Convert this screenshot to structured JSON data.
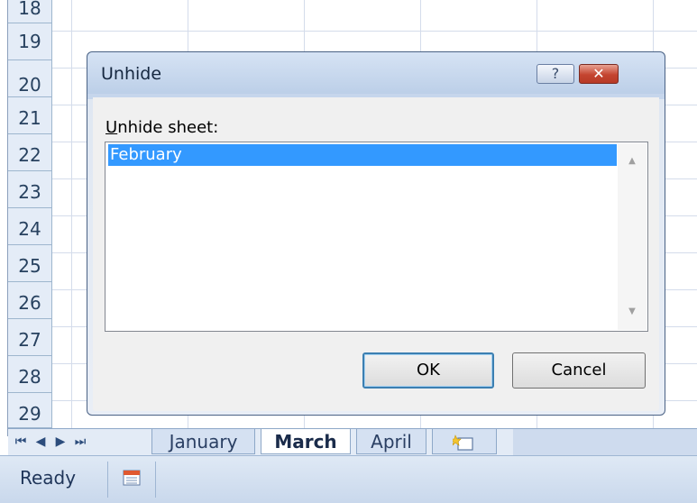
{
  "spreadsheet": {
    "row_numbers": [
      "18",
      "19",
      "20",
      "21",
      "22",
      "23",
      "24",
      "25",
      "26",
      "27",
      "28",
      "29"
    ]
  },
  "sheet_tabs": {
    "nav_icons": [
      "first-sheet-icon",
      "prev-sheet-icon",
      "next-sheet-icon",
      "last-sheet-icon"
    ],
    "tabs": [
      {
        "label": "January",
        "active": false
      },
      {
        "label": "March",
        "active": true
      },
      {
        "label": "April",
        "active": false
      }
    ],
    "insert_sheet_icon": "insert-sheet-icon"
  },
  "status_bar": {
    "status": "Ready",
    "icon": "macro-record-icon"
  },
  "dialog": {
    "title": "Unhide",
    "help_label": "?",
    "close_label": "✕",
    "label_prefix": "U",
    "label_rest": "nhide sheet:",
    "list_items": [
      "February"
    ],
    "selected_index": 0,
    "ok_label": "OK",
    "cancel_label": "Cancel"
  },
  "colors": {
    "selection": "#3399ff",
    "row_header_bg": "#e4ecf7",
    "close_button": "#c44430"
  }
}
